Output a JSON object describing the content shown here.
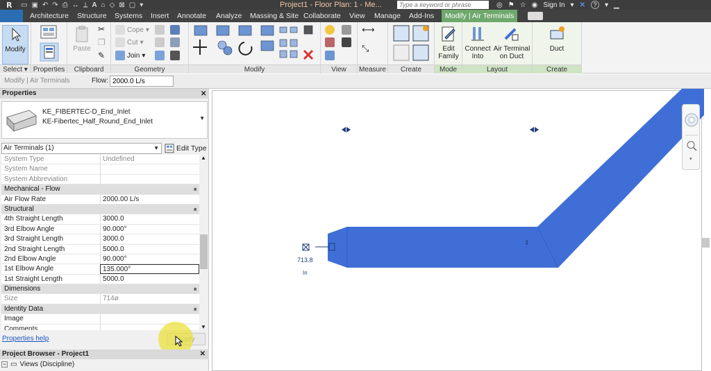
{
  "titlebar": {
    "title": "Project1 - Floor Plan: 1 - Me...",
    "search_placeholder": "Type a keyword or phrase",
    "sign_in": "Sign In",
    "help": "?"
  },
  "tabs": [
    {
      "label": "Architecture"
    },
    {
      "label": "Structure"
    },
    {
      "label": "Systems"
    },
    {
      "label": "Insert"
    },
    {
      "label": "Annotate"
    },
    {
      "label": "Analyze"
    },
    {
      "label": "Massing & Site"
    },
    {
      "label": "Collaborate"
    },
    {
      "label": "View"
    },
    {
      "label": "Manage"
    },
    {
      "label": "Add-Ins"
    },
    {
      "label": "Modify | Air Terminals",
      "active": true
    }
  ],
  "ribbon": {
    "select": {
      "button": "Modify",
      "label": "Select"
    },
    "properties": {
      "label": "Properties"
    },
    "clipboard": {
      "paste": "Paste",
      "label": "Clipboard"
    },
    "geometry": {
      "cope": "Cope",
      "cut": "Cut",
      "join": "Join",
      "label": "Geometry"
    },
    "modify": {
      "label": "Modify"
    },
    "view": {
      "label": "View"
    },
    "measure": {
      "label": "Measure"
    },
    "create": {
      "label": "Create"
    },
    "mode": {
      "button_l1": "Edit",
      "button_l2": "Family",
      "label": "Mode"
    },
    "layout": {
      "connect_l1": "Connect",
      "connect_l2": "Into",
      "airterm_l1": "Air Terminal",
      "airterm_l2": "on Duct",
      "label": "Layout"
    },
    "create_systems": {
      "button": "Duct",
      "label": "Create Systems"
    }
  },
  "optionsbar": {
    "context": "Modify | Air Terminals",
    "flow_label": "Flow:",
    "flow_value": "2000.0 L/s"
  },
  "properties": {
    "header": "Properties",
    "type_line1": "KE_FIBERTEC-D_End_Inlet",
    "type_line2": "KE-Fibertec_Half_Round_End_Inlet",
    "instance_filter": "Air Terminals (1)",
    "edit_type": "Edit Type",
    "rows": [
      {
        "k": "System Type",
        "v": "Undefined",
        "dim": true
      },
      {
        "k": "System Name",
        "v": "",
        "dim": true
      },
      {
        "k": "System Abbreviation",
        "v": "",
        "dim": true
      },
      {
        "k": "Mechanical - Flow",
        "section": true
      },
      {
        "k": "Air Flow Rate",
        "v": "2000.00 L/s"
      },
      {
        "k": "Structural",
        "section": true
      },
      {
        "k": "4th Straight Length",
        "v": "3000.0"
      },
      {
        "k": "3rd Elbow Angle",
        "v": "90.000°"
      },
      {
        "k": "3rd Straight Length",
        "v": "3000.0"
      },
      {
        "k": "2nd Straight Length",
        "v": "5000.0"
      },
      {
        "k": "2nd Elbow Angle",
        "v": "90.000°"
      },
      {
        "k": "1st Elbow Angle",
        "v": "135.000°",
        "edit": true
      },
      {
        "k": "1st Straight Length",
        "v": "5000.0"
      },
      {
        "k": "Dimensions",
        "section": true
      },
      {
        "k": "Size",
        "v": "714ø",
        "dim": true
      },
      {
        "k": "Identity Data",
        "section": true
      },
      {
        "k": "Image",
        "v": ""
      },
      {
        "k": "Comments",
        "v": ""
      }
    ],
    "help_link": "Properties help",
    "apply": "Apply"
  },
  "project_browser": {
    "header": "Project Browser - Project1",
    "views": "Views (Discipline)"
  },
  "canvas": {
    "terminal_label": "713.8",
    "terminal_sublabel": "In",
    "duct_color": "#3f6fd6"
  }
}
